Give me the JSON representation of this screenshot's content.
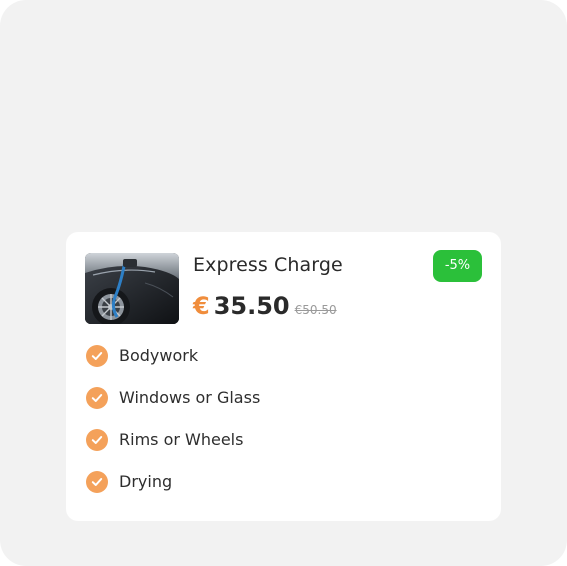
{
  "product": {
    "title": "Express Charge",
    "discount_badge": "-5%",
    "currency_symbol": "€",
    "price": "35.50",
    "old_price": "€50.50",
    "image_icon": "ev-charging-car-photo"
  },
  "features": [
    {
      "label": "Bodywork",
      "icon": "check-icon"
    },
    {
      "label": "Windows or Glass",
      "icon": "check-icon"
    },
    {
      "label": "Rims or Wheels",
      "icon": "check-icon"
    },
    {
      "label": "Drying",
      "icon": "check-icon"
    }
  ],
  "colors": {
    "accent_orange": "#f08d3c",
    "check_orange": "#f4a15a",
    "badge_green": "#2bc03a",
    "backdrop": "#f2f2f2"
  }
}
